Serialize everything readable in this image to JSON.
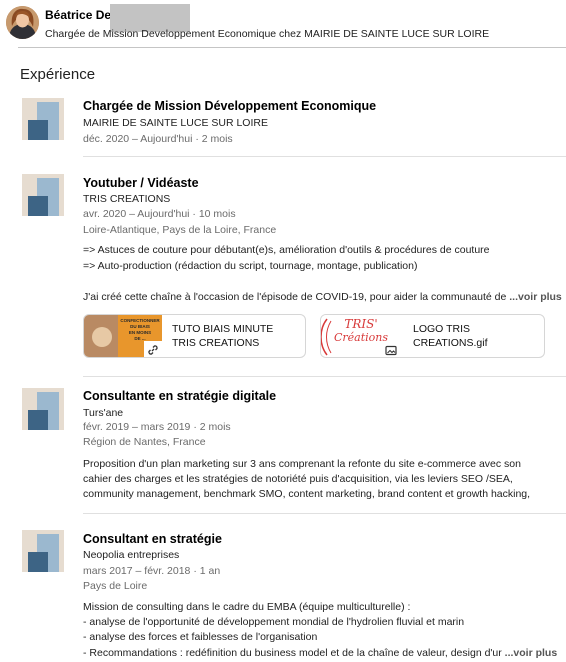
{
  "profile": {
    "name": "Béatrice Del",
    "headline": "Chargée de Mission Developpement Economique chez MAIRIE DE SAINTE LUCE SUR LOIRE"
  },
  "section_title": "Expérience",
  "experiences": [
    {
      "title": "Chargée de Mission Développement Economique",
      "company": "MAIRIE DE SAINTE LUCE SUR LOIRE",
      "dates": "déc. 2020 – Aujourd'hui · 2 mois"
    },
    {
      "title": "Youtuber / Vidéaste",
      "company": "TRIS CREATIONS",
      "dates": "avr. 2020 – Aujourd'hui · 10 mois",
      "location": "Loire-Atlantique, Pays de la Loire, France",
      "description": [
        "=> Astuces de couture pour débutant(e)s, amélioration d'outils & procédures de couture",
        "=> Auto-production (rédaction du script, tournage, montage, publication)"
      ],
      "teaser": "J'ai créé cette chaîne à l'occasion de l'épisode de COVID-19, pour aider la communauté de ",
      "see_more": "...voir plus",
      "media": [
        {
          "title_line1": "TUTO BIAIS MINUTE",
          "title_line2": "TRIS CREATIONS",
          "thumb_text": [
            "CONFECTIONNER",
            "DU BIAIS",
            "EN MOINS",
            "DE ..."
          ],
          "icon": "link-icon"
        },
        {
          "title_line1": "LOGO TRIS",
          "title_line2": "CREATIONS.gif",
          "thumb_text": [
            "TRIS'",
            "Créations"
          ],
          "icon": "image-icon"
        }
      ]
    },
    {
      "title": "Consultante en stratégie digitale",
      "company": "Turs'ane",
      "dates": "févr. 2019 – mars 2019 · 2 mois",
      "location": "Région de Nantes, France",
      "description": [
        "Proposition d'un plan marketing sur 3 ans comprenant la refonte du site e-commerce avec son",
        "cahier des charges et les stratégies de notoriété puis d'acquisition, via les leviers SEO /SEA,",
        "community management, benchmark SMO, content marketing, brand content et growth hacking,"
      ]
    },
    {
      "title": "Consultant en stratégie",
      "company": "Neopolia entreprises",
      "dates": "mars 2017 – févr. 2018 · 1 an",
      "location": "Pays de Loire",
      "description": [
        "Mission de consulting dans le cadre du EMBA (équipe multiculturelle) :",
        "- analyse de l'opportunité de développement mondial de l'hydrolien fluvial et marin",
        "- analyse des forces et faiblesses de l'organisation",
        "- Recommandations : redéfinition du business model et de la chaîne de valeur, design d'ur "
      ],
      "see_more": "...voir plus"
    }
  ],
  "colors": {
    "logo_back": "#e6dcd0",
    "logo_mid": "#9bb8cf",
    "logo_front": "#3d6485",
    "accent_orange": "#e89a2e",
    "accent_red": "#d83a3a"
  }
}
